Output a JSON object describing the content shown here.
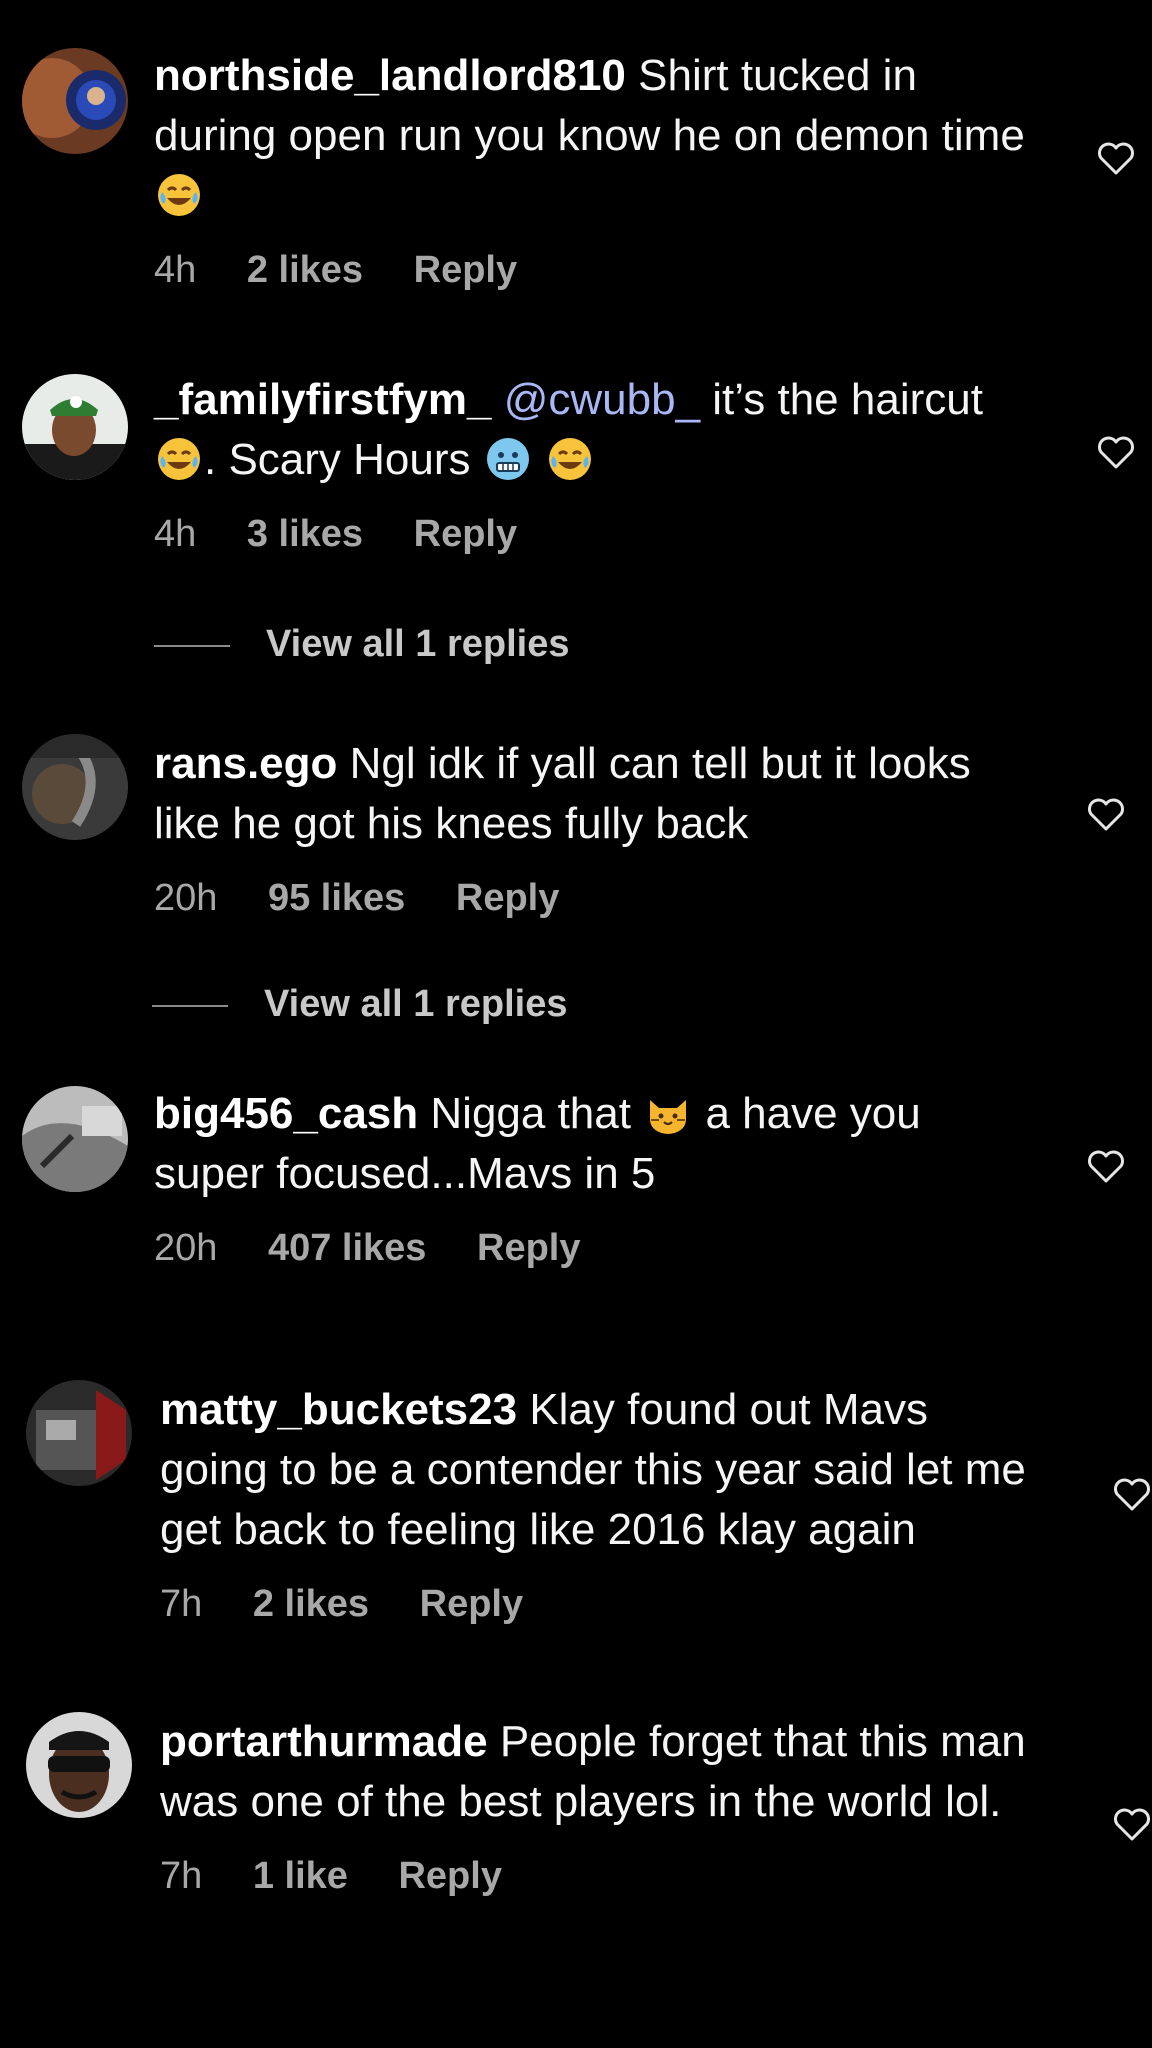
{
  "comments": [
    {
      "username": "northside_landlord810",
      "text_parts": [
        "Shirt tucked in during open run you know he on demon time"
      ],
      "emojis": [
        "face-with-tears-of-joy"
      ],
      "time": "4h",
      "likes": "2 likes",
      "reply": "Reply"
    },
    {
      "username": "_familyfirstfym_",
      "mention": "@cwubb_",
      "text_parts": [
        "it’s the haircut",
        ". Scary Hours"
      ],
      "emojis": [
        "face-with-tears-of-joy",
        "cold-face",
        "face-with-tears-of-joy"
      ],
      "time": "4h",
      "likes": "3 likes",
      "reply": "Reply",
      "view_replies": "View all 1 replies"
    },
    {
      "username": "rans.ego",
      "text_parts": [
        "Ngl idk if yall can tell but it looks like he got his knees fully back"
      ],
      "time": "20h",
      "likes": "95 likes",
      "reply": "Reply",
      "view_replies": "View all 1 replies"
    },
    {
      "username": "big456_cash",
      "text_parts": [
        "Nigga that",
        "a have you super focused...Mavs in 5"
      ],
      "emojis": [
        "cat-face"
      ],
      "time": "20h",
      "likes": "407 likes",
      "reply": "Reply"
    },
    {
      "username": "matty_buckets23",
      "text_parts": [
        "Klay found out Mavs going to be a contender this year said let me get back to feeling like 2016 klay again"
      ],
      "time": "7h",
      "likes": "2 likes",
      "reply": "Reply"
    },
    {
      "username": "portarthurmade",
      "text_parts": [
        "People forget that this man was one of the best players in the world lol."
      ],
      "time": "7h",
      "likes": "1 like",
      "reply": "Reply"
    }
  ],
  "colors": {
    "background": "#000000",
    "text": "#f5f5f5",
    "meta": "#a8a8a8",
    "mention": "#a9b8f5"
  },
  "icons": {
    "like": "heart-outline-icon"
  }
}
